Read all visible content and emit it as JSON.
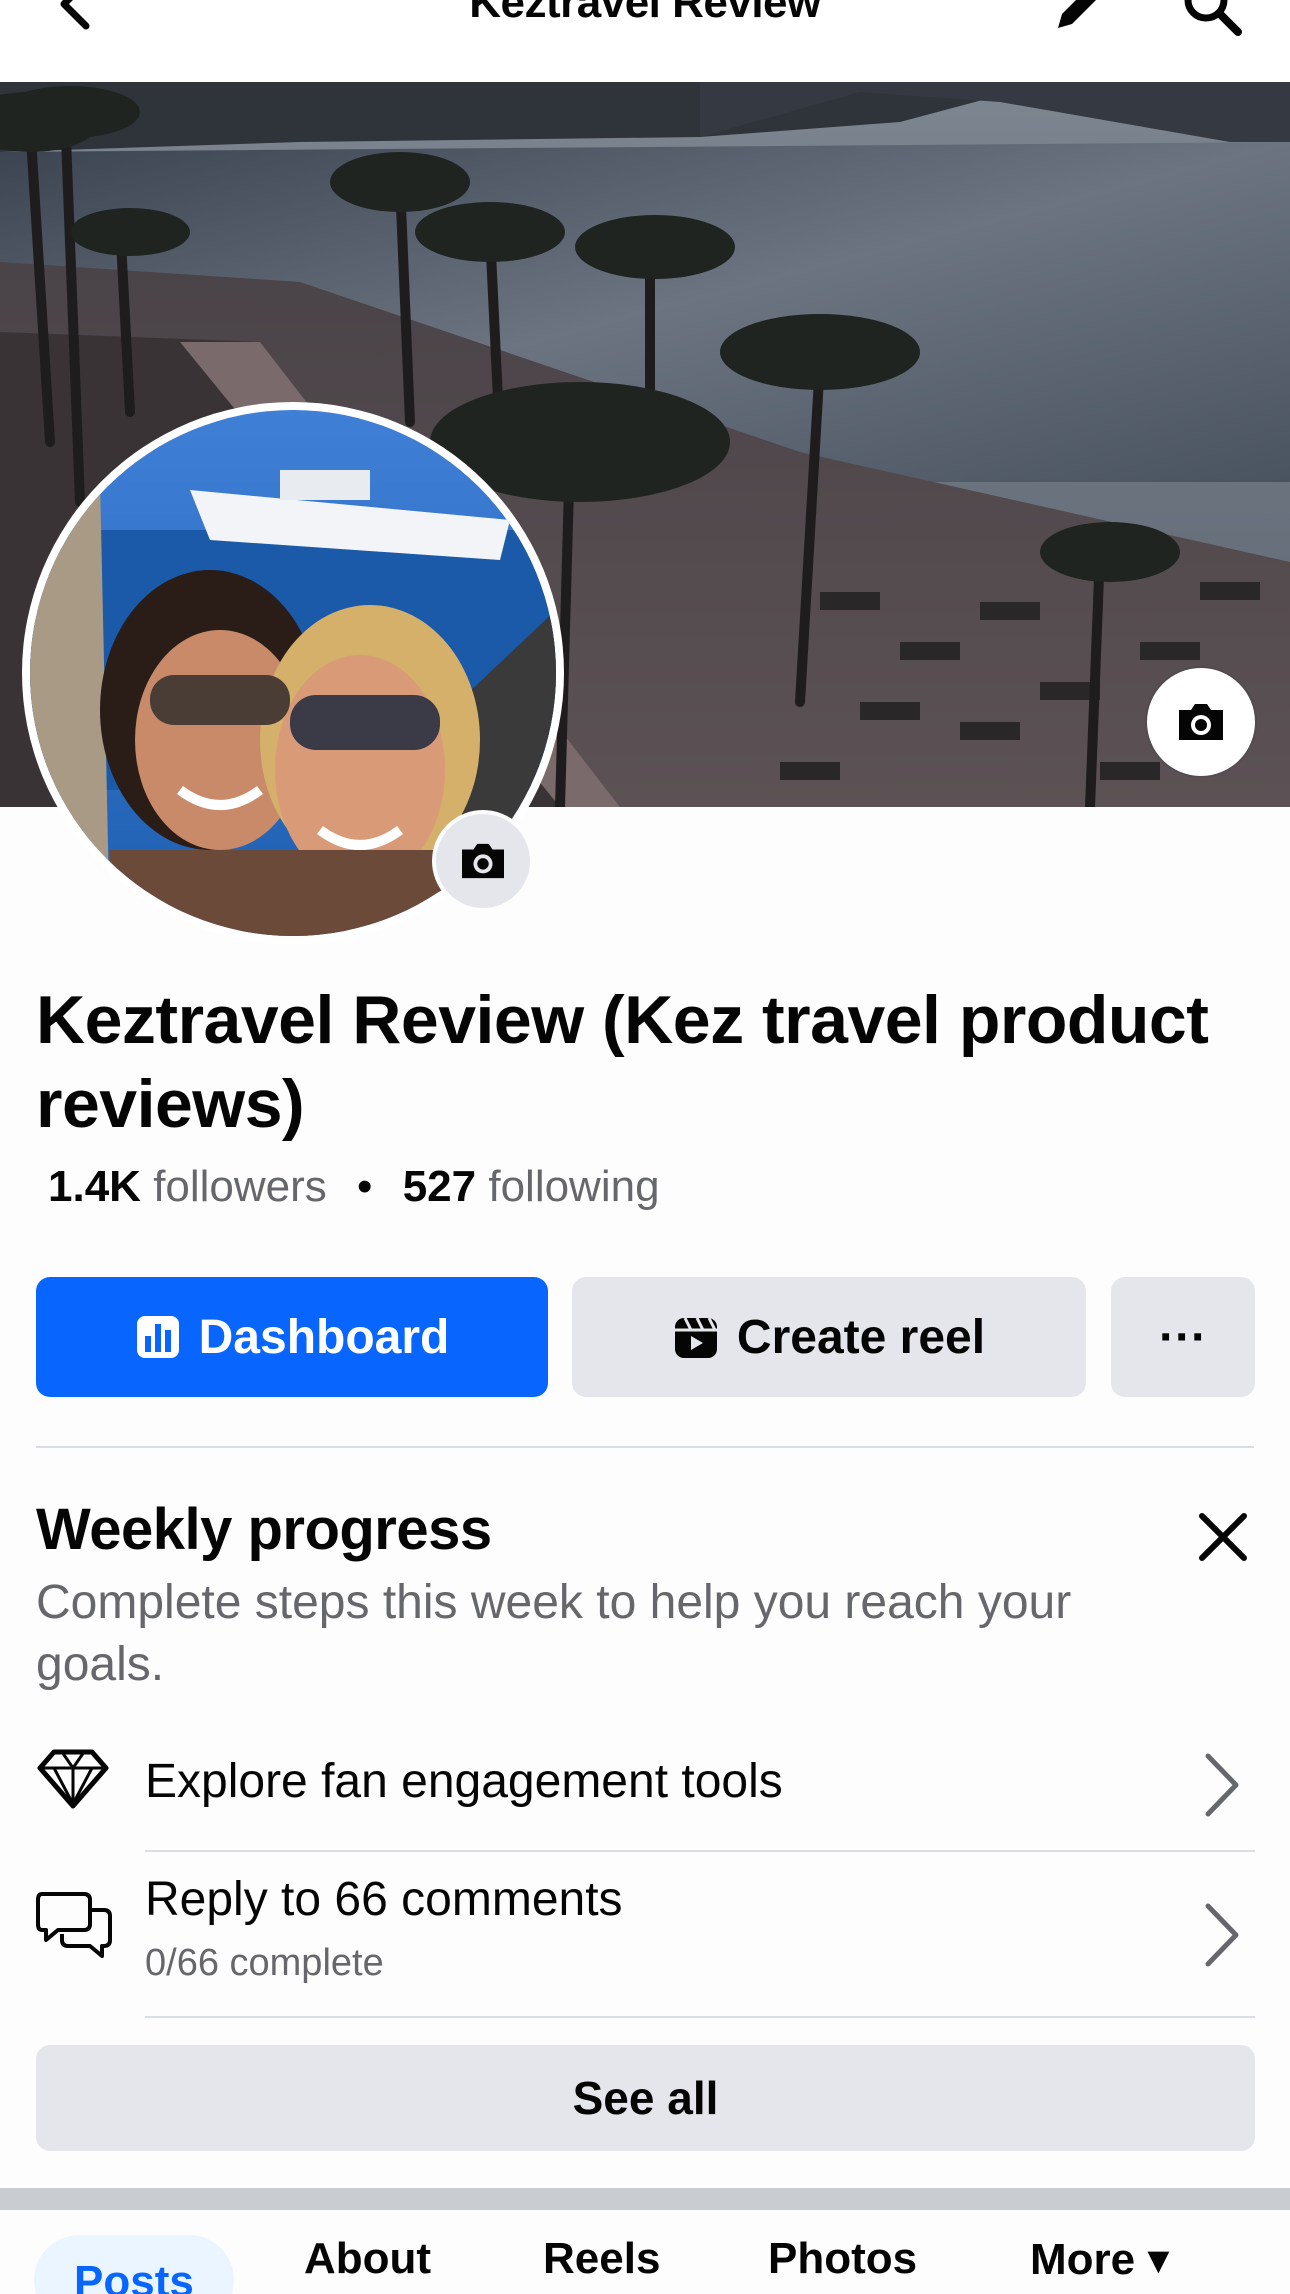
{
  "top_nav": {
    "title": "Keztravel Review"
  },
  "profile": {
    "name": "Keztravel Review (Kez travel product reviews)",
    "followers_count": "1.4K",
    "followers_label": "followers",
    "following_count": "527",
    "following_label": "following"
  },
  "actions": {
    "dashboard_label": "Dashboard",
    "create_reel_label": "Create reel",
    "more_label": "···"
  },
  "weekly_progress": {
    "title": "Weekly progress",
    "subtitle": "Complete steps this week to help you reach your goals.",
    "tasks": [
      {
        "label": "Explore fan engagement tools",
        "icon": "diamond-icon"
      },
      {
        "label": "Reply to 66 comments",
        "sub": "0/66 complete",
        "icon": "comments-icon"
      }
    ],
    "see_all_label": "See all"
  },
  "tabs": [
    {
      "label": "Posts",
      "active": true
    },
    {
      "label": "About"
    },
    {
      "label": "Reels"
    },
    {
      "label": "Photos"
    },
    {
      "label": "More ▾"
    }
  ],
  "colors": {
    "primary_blue": "#0866ff",
    "secondary_gray": "#e4e6eb",
    "muted_text": "#65676b"
  }
}
